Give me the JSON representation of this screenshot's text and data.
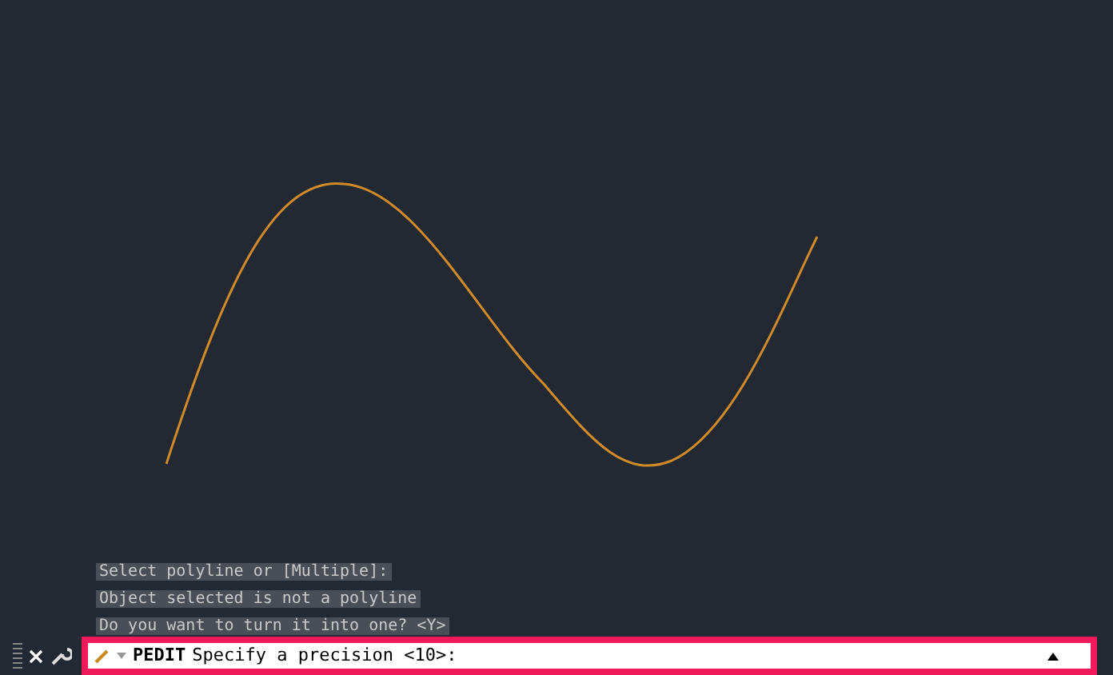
{
  "history": [
    "Select polyline or [Multiple]:",
    "Object selected is not a polyline",
    "Do you want to turn it into one? <Y>"
  ],
  "command_line": {
    "command": "PEDIT",
    "prompt": "Specify a precision <10>:",
    "highlighted": true
  }
}
